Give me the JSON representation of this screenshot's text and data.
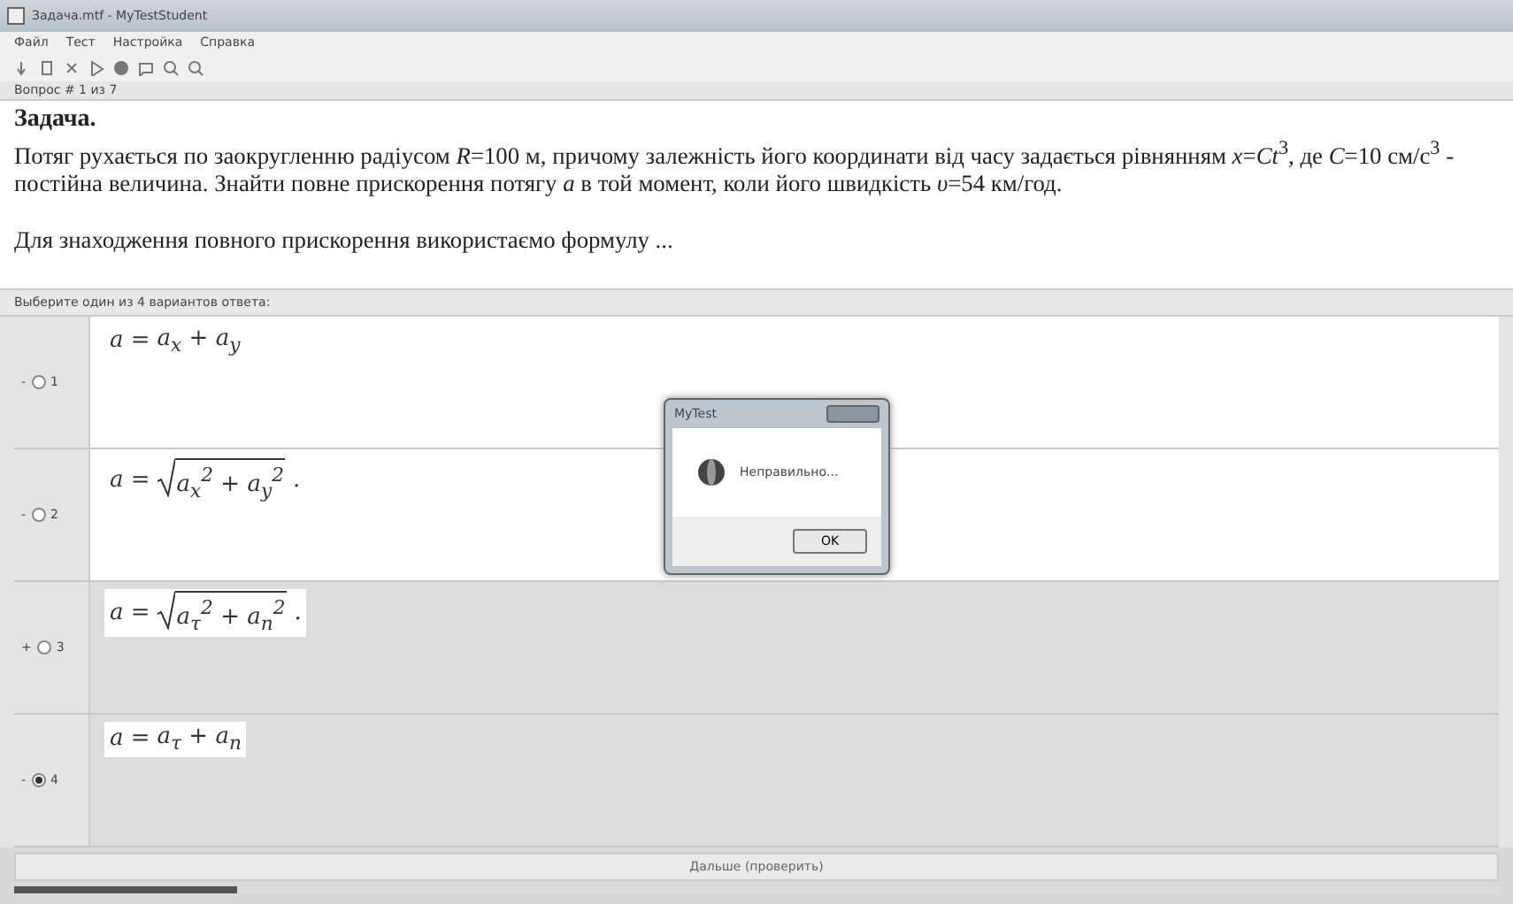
{
  "window": {
    "title": "Задача.mtf - MyTestStudent"
  },
  "menu": [
    "Файл",
    "Тест",
    "Настройка",
    "Справка"
  ],
  "question_number": "Вопрос # 1 из 7",
  "question": {
    "title": "Задача.",
    "text": "Потяг рухається по заокругленню радіусом *R*=100 м, причому залежність його координати від часу задається рівнянням *x*=*Ct*$^{3}$, де *C*=10 см/с$^{3}$ - постійна величина. Знайти повне прискорення потягу *a* в той момент, коли його швидкість *υ*=54 км/год.",
    "hint": "Для знаходження повного прискорення використаємо формулу ..."
  },
  "answers_label": "Выберите один из 4 вариантов ответа:",
  "answers": [
    {
      "marker": "-",
      "number": "1",
      "selected": false,
      "shaded": false,
      "kind": "plain",
      "lhs": "a =",
      "body": "a$_{x}$ + a$_{y}$"
    },
    {
      "marker": "-",
      "number": "2",
      "selected": false,
      "shaded": false,
      "kind": "sqrt",
      "lhs": "a =",
      "body": "a$_{x}$$^{2}$ + a$_{y}$$^{2}$",
      "tail": "."
    },
    {
      "marker": "+",
      "number": "3",
      "selected": false,
      "shaded": true,
      "kind": "sqrt",
      "lhs": "a =",
      "body": "a$_{τ}$$^{2}$ + a$_{n}$$^{2}$",
      "tail": "."
    },
    {
      "marker": "-",
      "number": "4",
      "selected": true,
      "shaded": true,
      "kind": "plain",
      "lhs": "a =",
      "body": "a$_{τ}$ + a$_{n}$"
    }
  ],
  "next_button": "Дальше (проверить)",
  "progress": {
    "level": 0.15
  },
  "dialog": {
    "title": "MyTest",
    "message": "Неправильно...",
    "button": "OK"
  }
}
